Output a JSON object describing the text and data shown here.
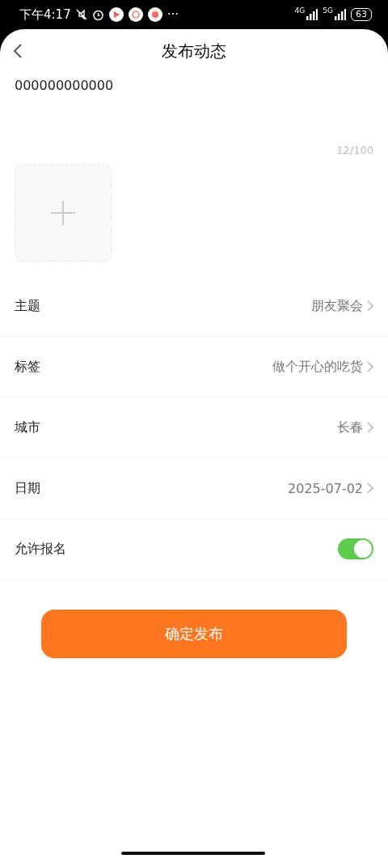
{
  "status_bar": {
    "time": "下午4:17",
    "more": "···",
    "network_1": "4G",
    "network_2": "5G",
    "battery": "63"
  },
  "header": {
    "title": "发布动态"
  },
  "content": {
    "value": "000000000000",
    "counter": "12/100"
  },
  "form_rows": [
    {
      "kind": "select",
      "label": "主题",
      "value": "朋友聚会"
    },
    {
      "kind": "select",
      "label": "标签",
      "value": "做个开心的吃货"
    },
    {
      "kind": "select",
      "label": "城市",
      "value": "长春"
    },
    {
      "kind": "select",
      "label": "日期",
      "value": "2025-07-02"
    },
    {
      "kind": "toggle",
      "label": "允许报名",
      "on": true
    }
  ],
  "submit_button": "确定发布"
}
